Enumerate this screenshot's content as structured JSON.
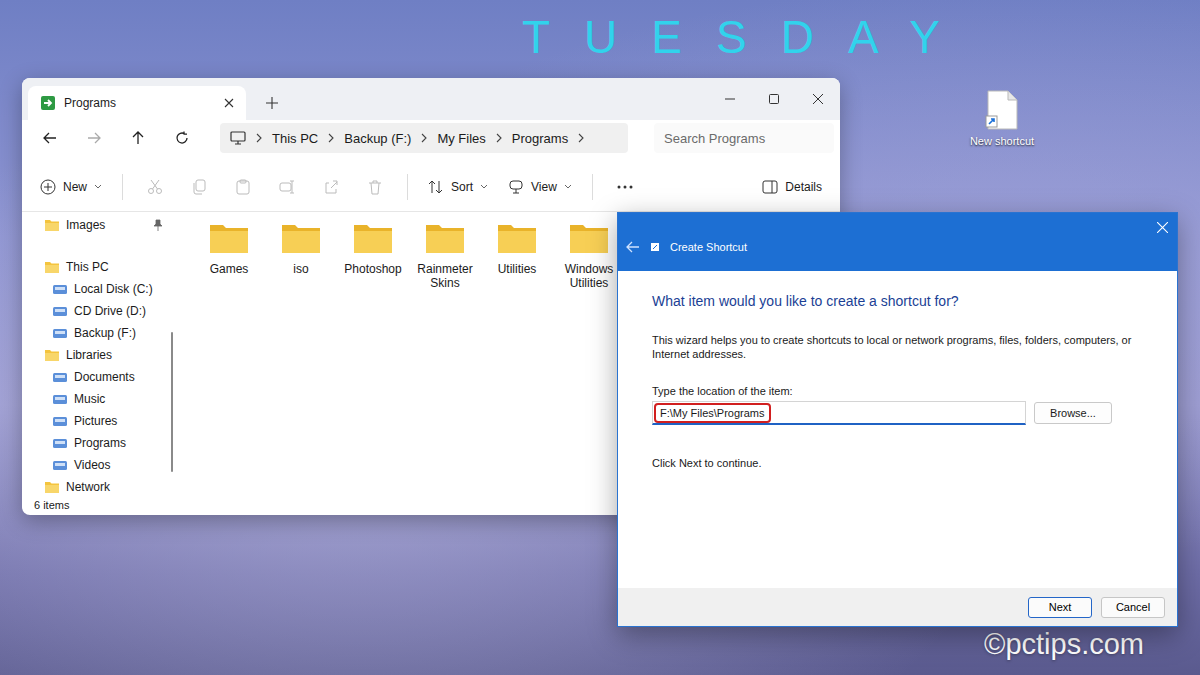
{
  "desktop": {
    "day": "TUESDAY",
    "icons": [
      {
        "label": "New shortcut"
      }
    ],
    "watermark": "©pctips.com"
  },
  "explorer": {
    "tab_title": "Programs",
    "breadcrumb": [
      "This PC",
      "Backup (F:)",
      "My Files",
      "Programs"
    ],
    "search": {
      "placeholder": "Search Programs"
    },
    "toolbar": {
      "new": "New",
      "sort": "Sort",
      "view": "View",
      "details": "Details"
    },
    "sidebar": [
      {
        "label": "Images",
        "pinned": true,
        "children": []
      },
      {
        "label": "This PC",
        "pinned": false,
        "children": [
          {
            "label": "Local Disk (C:)"
          },
          {
            "label": "CD Drive (D:)"
          },
          {
            "label": "Backup (F:)"
          }
        ]
      },
      {
        "label": "Libraries",
        "pinned": false,
        "children": [
          {
            "label": "Documents"
          },
          {
            "label": "Music"
          },
          {
            "label": "Pictures"
          },
          {
            "label": "Programs"
          },
          {
            "label": "Videos"
          }
        ]
      },
      {
        "label": "Network",
        "pinned": false,
        "children": []
      }
    ],
    "folders": [
      {
        "name": "Games"
      },
      {
        "name": "iso"
      },
      {
        "name": "Photoshop"
      },
      {
        "name": "Rainmeter Skins"
      },
      {
        "name": "Utilities"
      },
      {
        "name": "Windows Utilities"
      }
    ],
    "status": "6 items"
  },
  "dialog": {
    "title": "Create Shortcut",
    "heading": "What item would you like to create a shortcut for?",
    "description": "This wizard helps you to create shortcuts to local or network programs, files, folders, computers, or Internet addresses.",
    "field_label": "Type the location of the item:",
    "field_value": "F:\\My Files\\Programs",
    "field_highlighted": true,
    "browse": "Browse...",
    "hint": "Click Next to continue.",
    "buttons": [
      {
        "label": "Next",
        "default": true
      },
      {
        "label": "Cancel",
        "default": false
      }
    ]
  }
}
